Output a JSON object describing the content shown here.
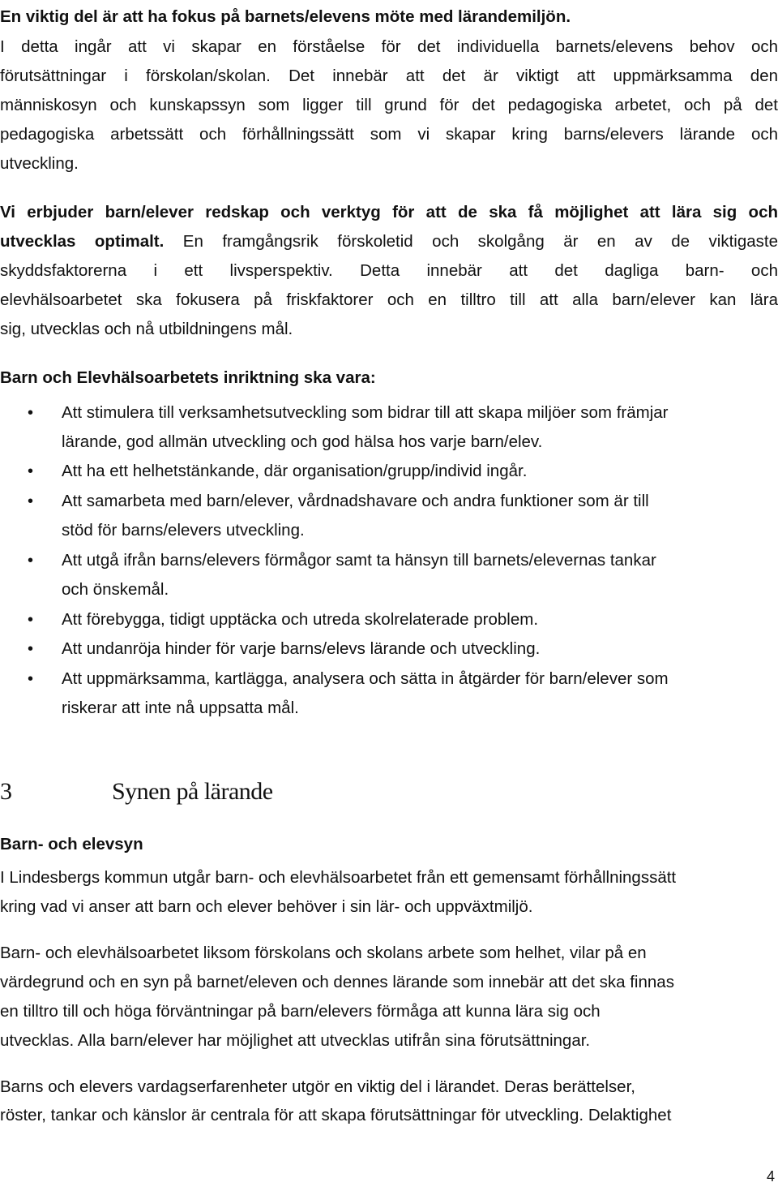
{
  "p1": {
    "lead_bold": "En viktig del är att ha fokus på barnets/elevens möte med lärandemiljön.",
    "lines": [
      "I detta ingår att vi skapar en förståelse för det individuella barnets/elevens behov och",
      "förutsättningar i förskolan/skolan. Det innebär att det är viktigt att uppmärksamma den",
      "människosyn och kunskapssyn som ligger till grund för det pedagogiska arbetet, och på det",
      "pedagogiska arbetssätt och förhållningssätt som vi skapar kring barns/elevers lärande och",
      "utveckling."
    ]
  },
  "p2": {
    "bold_line1": "Vi erbjuder barn/elever redskap och verktyg för att de ska få möjlighet att lära sig och",
    "bold_line2_start": "utvecklas optimalt.",
    "line2_rest": " En framgångsrik förskoletid och skolgång är en av de viktigaste",
    "lines": [
      "skyddsfaktorerna i ett livsperspektiv. Detta innebär att det dagliga barn- och",
      "elevhälsoarbetet ska fokusera på friskfaktorer och en tilltro till att alla barn/elever kan lära",
      "sig, utvecklas och nå utbildningens mål."
    ]
  },
  "list_heading": "Barn och Elevhälsoarbetets inriktning ska vara:",
  "bullet_symbol": "•",
  "bullets": [
    {
      "lines": [
        "Att stimulera till verksamhetsutveckling som bidrar till att skapa miljöer som främjar",
        "lärande, god allmän utveckling och god hälsa hos varje barn/elev."
      ]
    },
    {
      "lines": [
        "Att ha ett helhetstänkande, där organisation/grupp/individ ingår."
      ]
    },
    {
      "lines": [
        "Att samarbeta med barn/elever, vårdnadshavare och andra funktioner som är till",
        "stöd för barns/elevers utveckling."
      ]
    },
    {
      "lines": [
        "Att utgå ifrån barns/elevers förmågor samt ta hänsyn till barnets/elevernas tankar",
        "och önskemål."
      ]
    },
    {
      "lines": [
        "Att förebygga, tidigt upptäcka och utreda skolrelaterade problem."
      ]
    },
    {
      "lines": [
        "Att undanröja hinder för varje barns/elevs lärande och utveckling."
      ]
    },
    {
      "lines": [
        "Att uppmärksamma, kartlägga, analysera och sätta in åtgärder för barn/elever som",
        "riskerar att inte nå uppsatta mål."
      ]
    }
  ],
  "section": {
    "number": "3",
    "title": "Synen på lärande"
  },
  "subheading": "Barn- och elevsyn",
  "p3": [
    "I Lindesbergs kommun utgår barn- och elevhälsoarbetet från ett gemensamt förhållningssätt",
    "kring vad vi anser att barn och elever behöver i sin lär- och uppväxtmiljö."
  ],
  "p4": [
    "Barn- och elevhälsoarbetet liksom förskolans och skolans arbete som helhet, vilar på en",
    "värdegrund och en syn på barnet/eleven och dennes lärande som innebär att det ska finnas",
    "en tilltro till och höga förväntningar på barn/elevers förmåga att kunna lära sig och",
    "utvecklas. Alla barn/elever har möjlighet att utvecklas utifrån sina förutsättningar."
  ],
  "p5": [
    "Barns och elevers vardagserfarenheter utgör en viktig del i lärandet. Deras berättelser,",
    "röster, tankar och känslor är centrala för att skapa förutsättningar för utveckling. Delaktighet"
  ],
  "page_number": "4"
}
